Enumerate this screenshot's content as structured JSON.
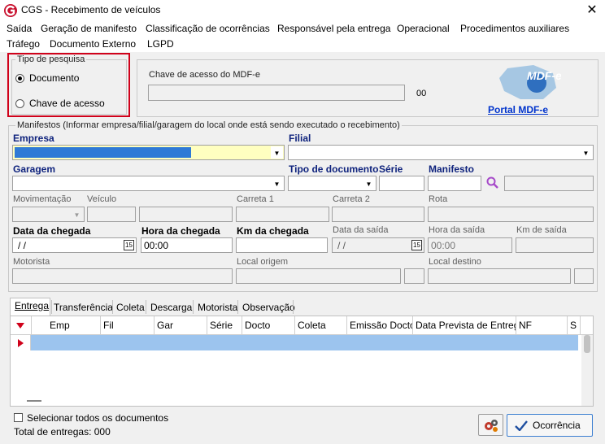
{
  "window": {
    "title": "CGS - Recebimento de veículos",
    "close_symbol": "✕"
  },
  "menu": {
    "row1": [
      "Saída",
      "Geração de manifesto",
      "Classificação de ocorrências",
      "Responsável pela entrega",
      "Operacional",
      "Procedimentos auxiliares"
    ],
    "row2": [
      "Tráfego",
      "Documento Externo",
      "LGPD"
    ]
  },
  "search_type": {
    "title": "Tipo de pesquisa",
    "options": [
      "Documento",
      "Chave de acesso"
    ],
    "selected": "Documento"
  },
  "mdfe": {
    "label": "Chave de acesso do MDF-e",
    "counter": "00",
    "logo_text": "MDF-e",
    "portal_link": "Portal MDF-e"
  },
  "manifestos": {
    "title": "Manifestos (Informar empresa/filial/garagem do local onde está sendo executado o recebimento)",
    "labels": {
      "empresa": "Empresa",
      "filial": "Filial",
      "garagem": "Garagem",
      "tipo_documento": "Tipo de documento",
      "serie": "Série",
      "manifesto": "Manifesto",
      "movimentacao": "Movimentação",
      "veiculo": "Veículo",
      "carreta1": "Carreta 1",
      "carreta2": "Carreta 2",
      "rota": "Rota",
      "data_chegada": "Data da chegada",
      "hora_chegada": "Hora da chegada",
      "km_chegada": "Km da chegada",
      "data_saida": "Data da saída",
      "hora_saida": "Hora da saída",
      "km_saida": "Km de saída",
      "motorista": "Motorista",
      "local_origem": "Local origem",
      "local_destino": "Local destino"
    },
    "values": {
      "data_chegada": " / /",
      "hora_chegada": "00:00",
      "data_saida": " / /",
      "hora_saida": "00:00",
      "calendar_day": "15"
    }
  },
  "tabs": [
    "Entrega",
    "Transferência",
    "Coleta",
    "Descarga",
    "Motorista",
    "Observação"
  ],
  "active_tab": "Entrega",
  "grid": {
    "columns": [
      "Emp",
      "Fil",
      "Gar",
      "Série",
      "Docto",
      "Coleta",
      "Emissão Docto",
      "Data Prevista de Entrega",
      "NF",
      "S"
    ]
  },
  "footer": {
    "select_all": "Selecionar todos os documentos",
    "total": "Total de entregas: 000",
    "ocorrencia_button": "Ocorrência"
  },
  "colors": {
    "highlight_red": "#d0021b",
    "selection_blue": "#2f7ad6",
    "selection_yellow": "#ffffc0",
    "label_blue": "#0f237d",
    "row_selected": "#9cc4ee",
    "link_blue": "#0033cc"
  }
}
